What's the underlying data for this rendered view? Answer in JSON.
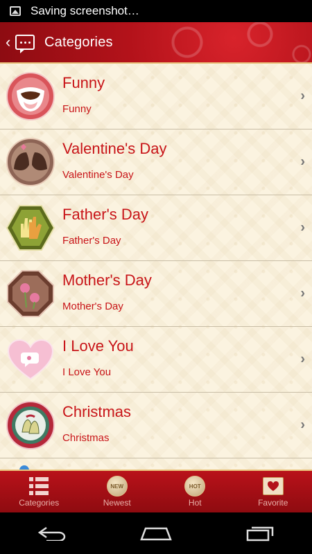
{
  "status_bar": {
    "text": "Saving screenshot…",
    "icon": "image-icon"
  },
  "header": {
    "title": "Categories",
    "back": "‹"
  },
  "categories": [
    {
      "title": "Funny",
      "subtitle": "Funny",
      "icon": "laughing-mouth-icon"
    },
    {
      "title": "Valentine's Day",
      "subtitle": "Valentine's Day",
      "icon": "kissing-couple-icon"
    },
    {
      "title": "Father's Day",
      "subtitle": "Father's Day",
      "icon": "hands-icon"
    },
    {
      "title": "Mother's Day",
      "subtitle": "Mother's Day",
      "icon": "carnation-icon"
    },
    {
      "title": "I Love You",
      "subtitle": "I Love You",
      "icon": "heart-icon"
    },
    {
      "title": "Christmas",
      "subtitle": "Christmas",
      "icon": "bells-icon"
    }
  ],
  "tabs": [
    {
      "label": "Categories",
      "icon": "list-icon",
      "badge": ""
    },
    {
      "label": "Newest",
      "icon": "new-badge-icon",
      "badge": "NEW"
    },
    {
      "label": "Hot",
      "icon": "hot-badge-icon",
      "badge": "HOT"
    },
    {
      "label": "Favorite",
      "icon": "favorite-heart-icon",
      "badge": ""
    }
  ],
  "colors": {
    "accent": "#c81418",
    "header_red": "#b3121a",
    "gold": "#e9c37b",
    "cream": "#fbf3e0"
  }
}
